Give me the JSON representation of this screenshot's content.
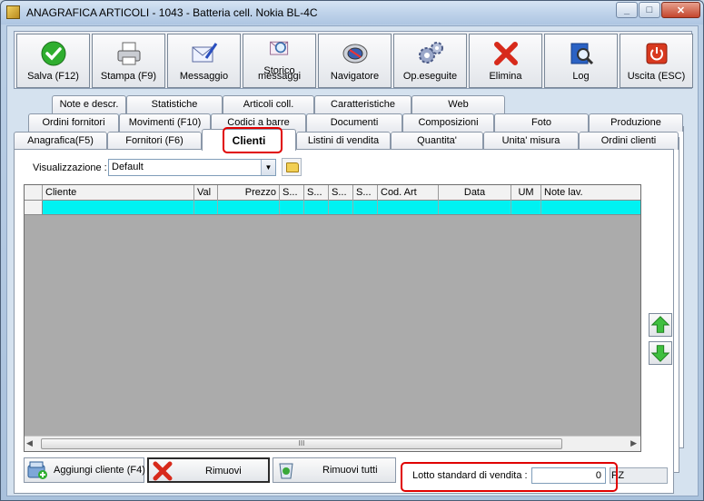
{
  "window": {
    "title": "ANAGRAFICA ARTICOLI - 1043 - Batteria cell. Nokia BL-4C",
    "min": "_",
    "max": "□",
    "close": "✕"
  },
  "toolbar": {
    "buttons": [
      {
        "label": "Salva (F12)",
        "icon": "check-icon"
      },
      {
        "label": "Stampa (F9)",
        "icon": "printer-icon"
      },
      {
        "label": "Messaggio",
        "icon": "envelope-pen-icon"
      },
      {
        "label1": "Storico",
        "label2": "messaggi",
        "icon": "envelope-search-icon"
      },
      {
        "label": "Navigatore",
        "icon": "compass-icon"
      },
      {
        "label": "Op.eseguite",
        "icon": "gears-icon"
      },
      {
        "label": "Elimina",
        "icon": "red-x-icon"
      },
      {
        "label": "Log",
        "icon": "log-book-icon"
      },
      {
        "label": "Uscita (ESC)",
        "icon": "power-icon"
      }
    ]
  },
  "tabs": {
    "row1": [
      "Note e descr.",
      "Statistiche",
      "Articoli coll.",
      "Caratteristiche",
      "Web"
    ],
    "row2": [
      "Ordini fornitori",
      "Movimenti (F10)",
      "Codici a barre",
      "Documenti",
      "Composizioni",
      "Foto",
      "Produzione"
    ],
    "row3": [
      "Anagrafica(F5)",
      "Fornitori (F6)",
      "Clienti",
      "Listini di vendita",
      "Quantita'",
      "Unita' misura",
      "Ordini clienti"
    ],
    "active": "Clienti"
  },
  "view": {
    "label": "Visualizzazione :",
    "selected": "Default",
    "dropdown_arrow": "▼"
  },
  "grid": {
    "columns": [
      "Cliente",
      "Val",
      "Prezzo",
      "S...",
      "S...",
      "S...",
      "S...",
      "Cod. Art",
      "Data",
      "UM",
      "Note lav."
    ],
    "rows": [
      [
        "",
        "",
        "",
        "",
        "",
        "",
        "",
        "",
        "",
        "",
        ""
      ]
    ],
    "scroll_grip": "III",
    "scroll_left": "◀",
    "scroll_right": "▶"
  },
  "buttons": {
    "add": "Aggiungi cliente (F4)",
    "remove": "Rimuovi",
    "remove_all": "Rimuovi tutti"
  },
  "lotto": {
    "label": "Lotto standard di vendita :",
    "value": "0",
    "unit": "PZ"
  },
  "colors": {
    "accent_highlight": "#e00000",
    "selected_row": "#00f2f2",
    "grid_background": "#ababab"
  }
}
